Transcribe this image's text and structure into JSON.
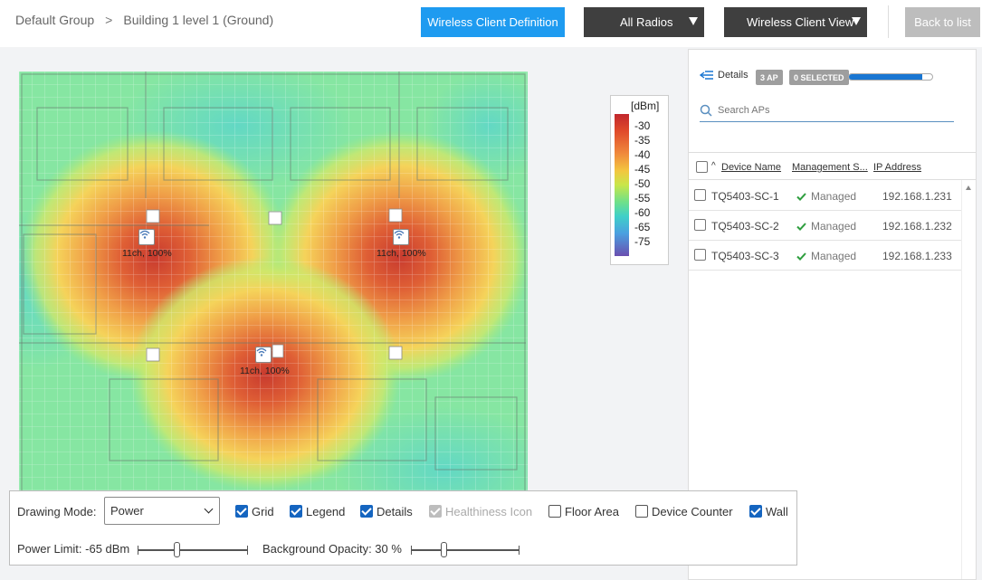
{
  "header": {
    "breadcrumb": [
      "Default Group",
      "Building 1 level 1 (Ground)"
    ],
    "breadcrumb_sep": ">",
    "wireless_client_definition": "Wireless Client Definition",
    "radios": "All Radios",
    "client_view": "Wireless Client View",
    "back": "Back to list"
  },
  "map": {
    "aps": [
      {
        "label": "11ch, 100%"
      },
      {
        "label": "11ch, 100%"
      },
      {
        "label": "11ch, 100%"
      }
    ]
  },
  "legend": {
    "title": "[dBm]",
    "ticks": [
      "-30",
      "-35",
      "-40",
      "-45",
      "-50",
      "-55",
      "-60",
      "-65",
      "-75"
    ]
  },
  "panel": {
    "details": "Details",
    "ap_count": "3 AP",
    "selected": "0 SELECTED",
    "progress_fraction": 0.88,
    "search_placeholder": "Search APs",
    "columns": [
      "Device Name",
      "Management S...",
      "IP Address"
    ],
    "rows": [
      {
        "name": "TQ5403-SC-1",
        "status": "Managed",
        "ip": "192.168.1.231"
      },
      {
        "name": "TQ5403-SC-2",
        "status": "Managed",
        "ip": "192.168.1.232"
      },
      {
        "name": "TQ5403-SC-3",
        "status": "Managed",
        "ip": "192.168.1.233"
      }
    ]
  },
  "controls": {
    "drawing_mode_label": "Drawing Mode:",
    "drawing_mode_value": "Power",
    "grid": "Grid",
    "legend": "Legend",
    "details": "Details",
    "healthiness": "Healthiness Icon",
    "floor_area": "Floor Area",
    "device_counter": "Device Counter",
    "wall": "Wall",
    "power_limit": "Power Limit: -65 dBm",
    "background_opacity": "Background Opacity: 30 %",
    "power_limit_fraction": 0.35,
    "background_opacity_fraction": 0.3
  },
  "colors": {
    "accent": "#1e9bf0",
    "dark_button": "#3f3f3f",
    "managed_green": "#2e9e3e"
  }
}
